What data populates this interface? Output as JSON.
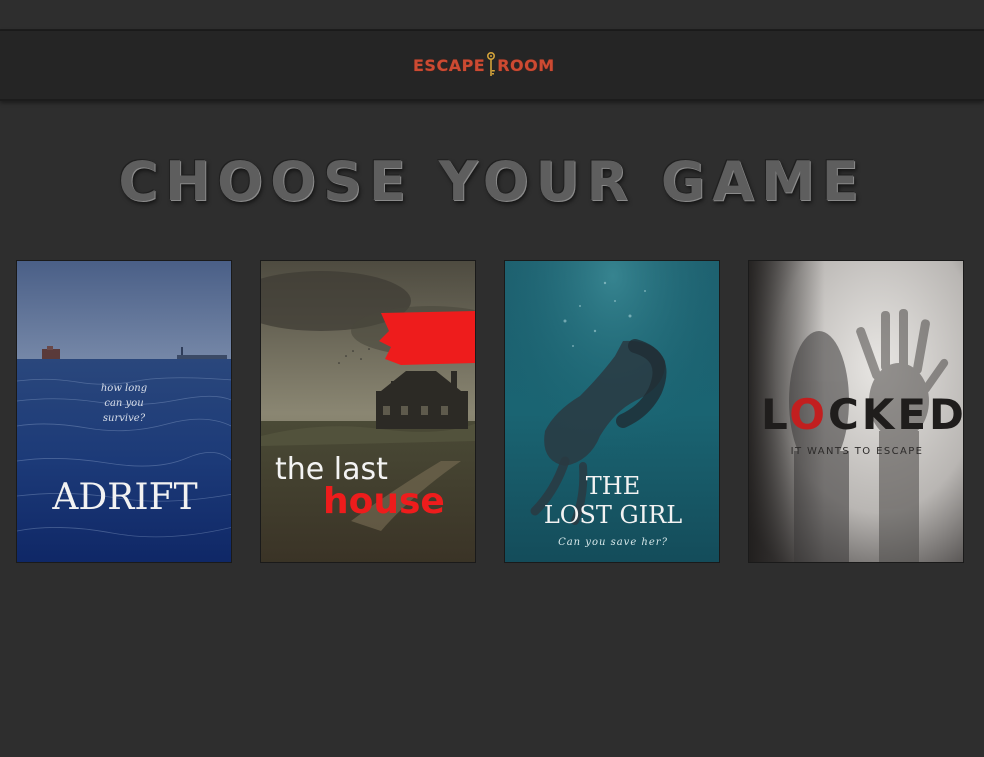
{
  "header": {
    "logo_left": "ESCAPE",
    "logo_right": "ROOM"
  },
  "main": {
    "title": "CHOOSE YOUR GAME"
  },
  "games": [
    {
      "tagline_1": "how long",
      "tagline_2": "can you",
      "tagline_3": "survive?",
      "title": "ADRIFT"
    },
    {
      "title_1": "the last",
      "title_2": "house"
    },
    {
      "title_1": "THE",
      "title_2": "LOST GIRL",
      "tagline": "Can you save her?"
    },
    {
      "title_l": "L",
      "title_o": "O",
      "title_rest": "CKED",
      "tagline": "IT WANTS TO ESCAPE"
    }
  ],
  "colors": {
    "background": "#2e2e2e",
    "header": "#252525",
    "logo": "#cc4a32",
    "title": "#5e5e5e",
    "locked_accent": "#c21f1f",
    "last_house_accent": "#ee1c1c"
  }
}
